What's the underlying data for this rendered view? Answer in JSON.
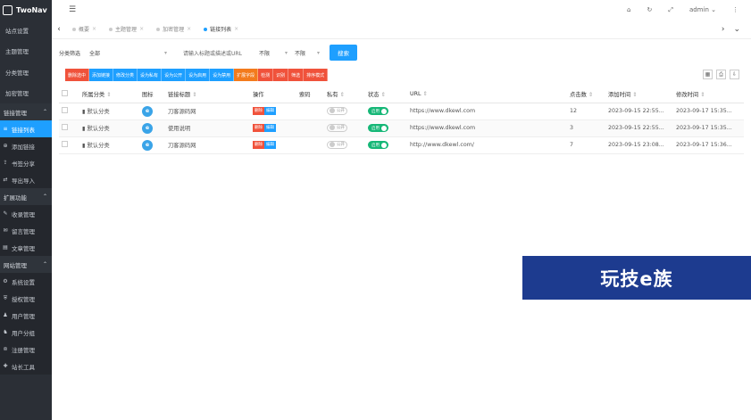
{
  "app": {
    "name": "TwoNav"
  },
  "sidebar": {
    "top_items": [
      "站点设置",
      "主题管理",
      "分类管理",
      "加密管理"
    ],
    "groups": [
      {
        "label": "链接管理",
        "items": [
          {
            "label": "链接列表",
            "icon": "list-icon",
            "glyph": "≡",
            "active": true
          },
          {
            "label": "添加链接",
            "icon": "plus-icon",
            "glyph": "⊕"
          },
          {
            "label": "书签分享",
            "icon": "share-icon",
            "glyph": "⇪"
          },
          {
            "label": "导出导入",
            "icon": "export-icon",
            "glyph": "⇄"
          }
        ]
      },
      {
        "label": "扩展功能",
        "items": [
          {
            "label": "收录管理",
            "icon": "pencil-icon",
            "glyph": "✎"
          },
          {
            "label": "留言管理",
            "icon": "message-icon",
            "glyph": "✉"
          },
          {
            "label": "文章管理",
            "icon": "file-icon",
            "glyph": "▤"
          }
        ]
      },
      {
        "label": "网站管理",
        "items": [
          {
            "label": "系统设置",
            "icon": "cogs-icon",
            "glyph": "⚙"
          },
          {
            "label": "授权管理",
            "icon": "shield-icon",
            "glyph": "⛨"
          },
          {
            "label": "用户管理",
            "icon": "user-icon",
            "glyph": "♟"
          },
          {
            "label": "用户分组",
            "icon": "users-icon",
            "glyph": "♞"
          },
          {
            "label": "注册管理",
            "icon": "register-icon",
            "glyph": "⊚"
          },
          {
            "label": "站长工具",
            "icon": "tools-icon",
            "glyph": "✚"
          }
        ]
      }
    ]
  },
  "topbar": {
    "user": "admin"
  },
  "tabs": [
    {
      "label": "概要"
    },
    {
      "label": "主题管理"
    },
    {
      "label": "加密管理"
    },
    {
      "label": "链接列表",
      "active": true
    }
  ],
  "filter": {
    "label": "分类筛选",
    "category": "全部",
    "search_placeholder": "请输入标题或描述或URL",
    "select1": "不限",
    "select2": "不限",
    "search_button": "搜索"
  },
  "toolbar": [
    {
      "label": "删除选中",
      "color": "red"
    },
    {
      "label": "添加链接",
      "color": "blue"
    },
    {
      "label": "修改分类",
      "color": "blue"
    },
    {
      "label": "设为私有",
      "color": "blue"
    },
    {
      "label": "设为公开",
      "color": "blue"
    },
    {
      "label": "设为启用",
      "color": "blue"
    },
    {
      "label": "设为禁用",
      "color": "blue"
    },
    {
      "label": "扩展字段",
      "color": "orange"
    },
    {
      "label": "检测",
      "color": "red"
    },
    {
      "label": "识别",
      "color": "red"
    },
    {
      "label": "筛选",
      "color": "red"
    },
    {
      "label": "排序模式",
      "color": "red"
    }
  ],
  "table": {
    "headers": {
      "category": "所属分类",
      "icon": "图标",
      "title": "链接标题",
      "ops": "操作",
      "index": "索码",
      "private": "私有",
      "status": "状态",
      "url": "URL",
      "clicks": "点击数",
      "added": "添加时间",
      "modified": "修改时间"
    },
    "ops": {
      "delete": "删除",
      "edit": "编辑"
    },
    "rows": [
      {
        "category": "默认分类",
        "title": "刀客源码网",
        "private": "公开",
        "status": "启用",
        "url": "https://www.dkewl.com",
        "clicks": "12",
        "added": "2023-09-15 22:55...",
        "modified": "2023-09-17 15:35..."
      },
      {
        "category": "默认分类",
        "title": "使用说明",
        "private": "公开",
        "status": "启用",
        "url": "https://www.dkewl.com",
        "clicks": "3",
        "added": "2023-09-15 22:55...",
        "modified": "2023-09-17 15:35..."
      },
      {
        "category": "默认分类",
        "title": "刀客源码网",
        "private": "公开",
        "status": "启用",
        "url": "http://www.dkewl.com/",
        "clicks": "7",
        "added": "2023-09-15 23:08...",
        "modified": "2023-09-17 15:36..."
      }
    ]
  },
  "watermark": "玩技e族"
}
